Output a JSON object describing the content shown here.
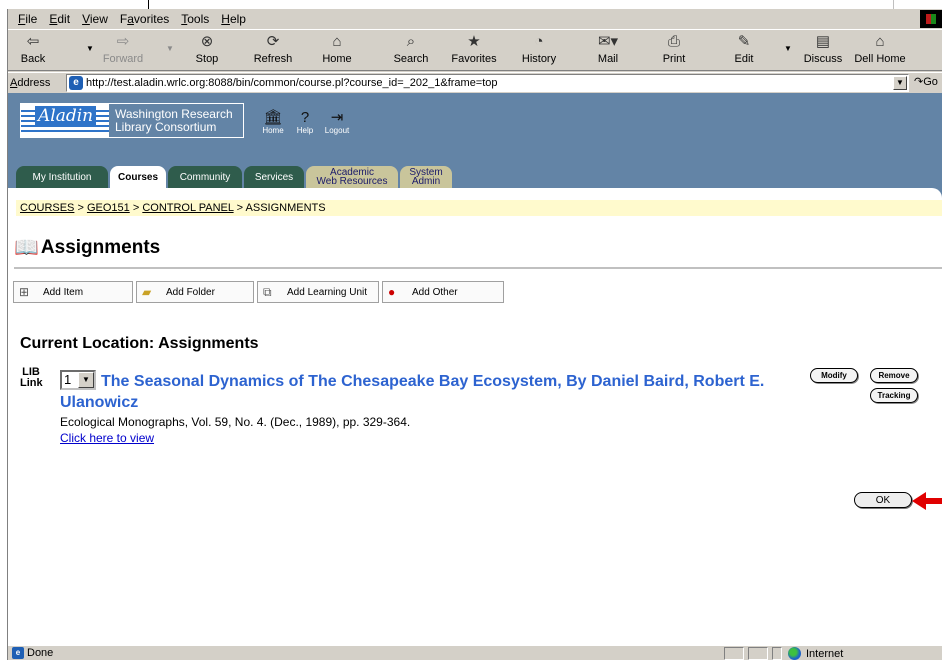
{
  "menu": [
    {
      "prefix": "",
      "key": "F",
      "rest": "ile"
    },
    {
      "prefix": "",
      "key": "E",
      "rest": "dit"
    },
    {
      "prefix": "",
      "key": "V",
      "rest": "iew"
    },
    {
      "prefix": "F",
      "key": "a",
      "rest": "vorites"
    },
    {
      "prefix": "",
      "key": "T",
      "rest": "ools"
    },
    {
      "prefix": "",
      "key": "H",
      "rest": "elp"
    }
  ],
  "toolbar": {
    "back": "Back",
    "forward": "Forward",
    "stop": "Stop",
    "refresh": "Refresh",
    "home": "Home",
    "search": "Search",
    "favorites": "Favorites",
    "history": "History",
    "mail": "Mail",
    "print": "Print",
    "edit": "Edit",
    "discuss": "Discuss",
    "dellhome": "Dell Home"
  },
  "address": {
    "label": "Address",
    "url": "http://test.aladin.wrlc.org:8088/bin/common/course.pl?course_id=_202_1&frame=top",
    "go": "Go"
  },
  "header": {
    "logo_mark": "Aladin",
    "logo_line1": "Washington Research",
    "logo_line2": "Library Consortium",
    "icons": [
      {
        "label": "Home",
        "glyph": "🏛"
      },
      {
        "label": "Help",
        "glyph": "?"
      },
      {
        "label": "Logout",
        "glyph": "⇥"
      }
    ]
  },
  "tabs": {
    "my_institution": "My Institution",
    "courses": "Courses",
    "community": "Community",
    "services": "Services",
    "academic_line1": "Academic",
    "academic_line2": "Web Resources",
    "system_line1": "System",
    "system_line2": "Admin"
  },
  "breadcrumb": {
    "courses": "COURSES",
    "course": "GEO151",
    "control_panel": "CONTROL PANEL",
    "current": "ASSIGNMENTS",
    "sep": " > "
  },
  "page": {
    "title": "Assignments",
    "current_location": "Current Location: Assignments"
  },
  "actions": {
    "add_item": "Add Item",
    "add_folder": "Add Folder",
    "add_learning_unit": "Add Learning Unit",
    "add_other": "Add Other"
  },
  "item": {
    "icon_line1": "LIB",
    "icon_line2": "Link",
    "order": "1",
    "title": "The Seasonal Dynamics of The Chesapeake Bay Ecosystem, By Daniel Baird, Robert E. Ulanowicz",
    "citation": "Ecological Monographs, Vol. 59, No. 4. (Dec., 1989), pp. 329-364.",
    "link": "Click here to view",
    "modify": "Modify",
    "remove": "Remove",
    "tracking": "Tracking"
  },
  "ok": "OK",
  "status": {
    "text": "Done",
    "zone": "Internet"
  },
  "colors": {
    "header_bg": "#6384a6",
    "tab_dark": "#2f5c4c",
    "tab_tan": "#c9c59b",
    "breadcrumb_bg": "#fffacd",
    "item_title": "#2d63d0",
    "arrow": "#e00000"
  }
}
